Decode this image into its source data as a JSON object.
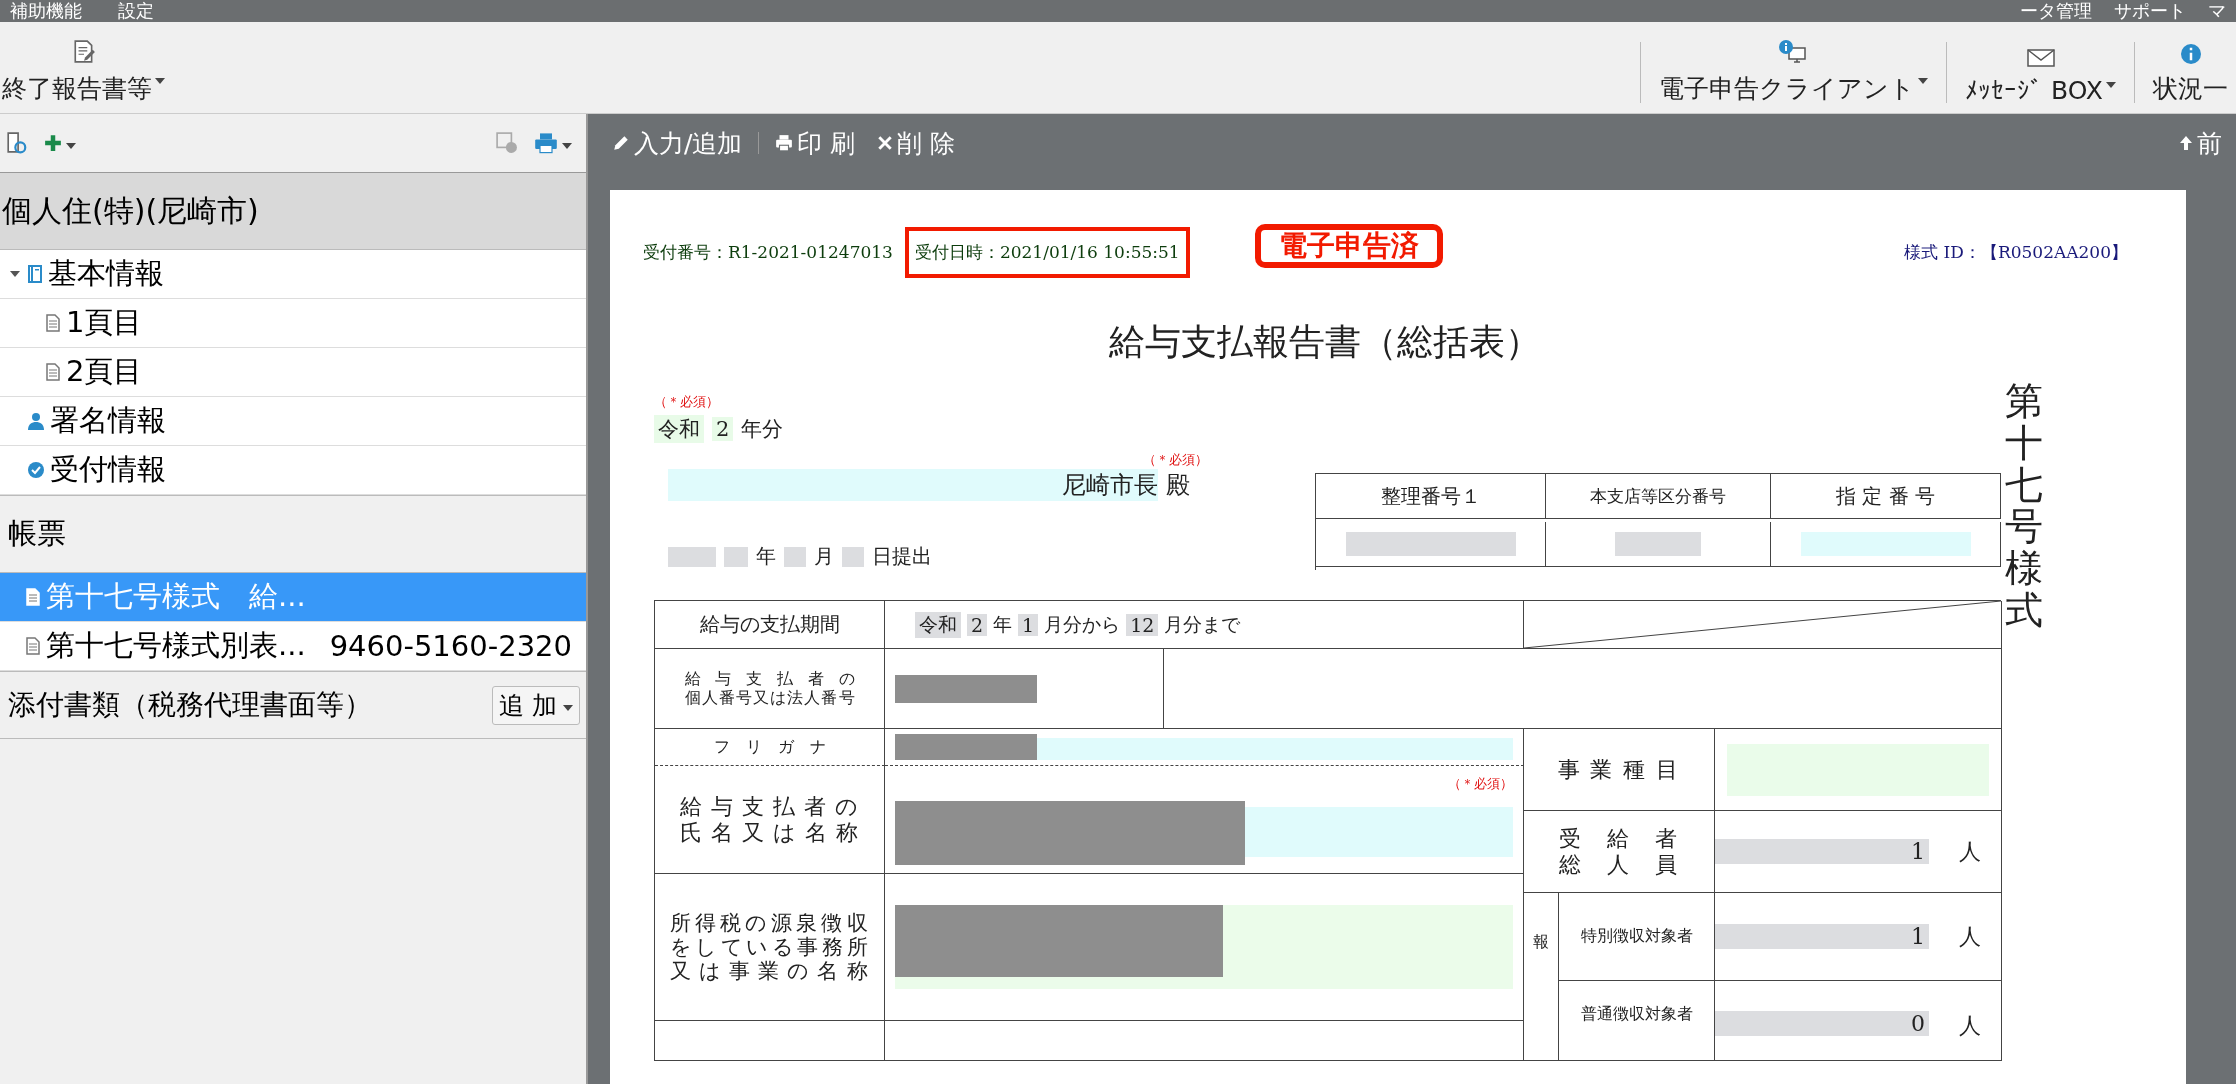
{
  "menu_bar": {
    "left": [
      "補助機能",
      "設定"
    ],
    "right": [
      "ータ管理",
      "サポート",
      "マ"
    ]
  },
  "toolbar": {
    "left": [
      {
        "label": "終了報告書等",
        "dropdown": true
      }
    ],
    "right": [
      {
        "label": "電子申告クライアント",
        "kind": "monitor",
        "dropdown": true
      },
      {
        "label": "ﾒｯｾｰｼﾞ BOX",
        "kind": "mail",
        "dropdown": true
      },
      {
        "label": "状況一",
        "kind": "info",
        "dropdown": false
      }
    ]
  },
  "left_panel": {
    "header": "個人住(特)(尼崎市)",
    "tree": [
      {
        "label": "基本情報",
        "kind": "book",
        "expanded": true,
        "children": [
          {
            "label": "1頁目",
            "kind": "page"
          },
          {
            "label": "2頁目",
            "kind": "page"
          }
        ]
      },
      {
        "label": "署名情報",
        "kind": "person"
      },
      {
        "label": "受付情報",
        "kind": "check"
      }
    ],
    "forms_header": "帳票",
    "forms": [
      {
        "label": "第十七号様式　給...",
        "selected": true
      },
      {
        "label": "第十七号様式別表...",
        "number": "9460-5160-2320",
        "selected": false
      }
    ],
    "attachments": {
      "label": "添付書類（税務代理書面等）",
      "button": "追 加"
    }
  },
  "doc_toolbar": {
    "buttons": [
      {
        "label": "入力/追加",
        "kind": "pencil"
      },
      {
        "label": "印 刷",
        "kind": "print"
      },
      {
        "label": "削 除",
        "kind": "close"
      }
    ],
    "right": "前"
  },
  "form": {
    "receipt_number": "受付番号：R1-2021-01247013",
    "receipt_datetime": "受付日時：2021/01/16 10:55:51",
    "stamp": "電子申告済",
    "style_id": "様式 ID：【R0502AA200】",
    "title": "給与支払報告書（総括表）",
    "vertical_title": "第十七号様式",
    "year_required": "（＊必須）",
    "addressee_required": "（＊必須）",
    "year": {
      "era": "令和",
      "value": "2",
      "suffix": "年分"
    },
    "addressee": {
      "value": "尼崎市長",
      "suffix": "殿"
    },
    "submitted": {
      "year": "年",
      "month": "月",
      "day": "日提出"
    },
    "id_table": {
      "headers": [
        "整理番号１",
        "本支店等区分番号",
        "指 定 番 号"
      ]
    },
    "rows": {
      "period_label": "給与の支払期間",
      "period": {
        "era": "令和",
        "year": "2",
        "year_unit": "年",
        "from": "1",
        "from_unit": "月分から",
        "to": "12",
        "to_unit": "月分まで"
      },
      "number_label": [
        "給与支払者の",
        "個人番号又は法人番号"
      ],
      "furigana_label": "フ　リ　ガ　ナ",
      "name_required": "（＊必須）",
      "name_label": [
        "給与支払者の",
        "氏名又は名称"
      ],
      "office_label": [
        "所得税の源泉徴収",
        "をしている事務所",
        "又は事業の名称"
      ],
      "business_label": "事 業 種 目",
      "recipients_label": [
        "受給者",
        "総人員"
      ],
      "recipients": "1",
      "recipients_unit": "人",
      "report_label": "報",
      "special_label": "特別徴収対象者",
      "special": "1",
      "special_unit": "人",
      "ordinary_label": "普通徴収対象者",
      "ordinary": "0",
      "ordinary_unit": "人"
    }
  }
}
